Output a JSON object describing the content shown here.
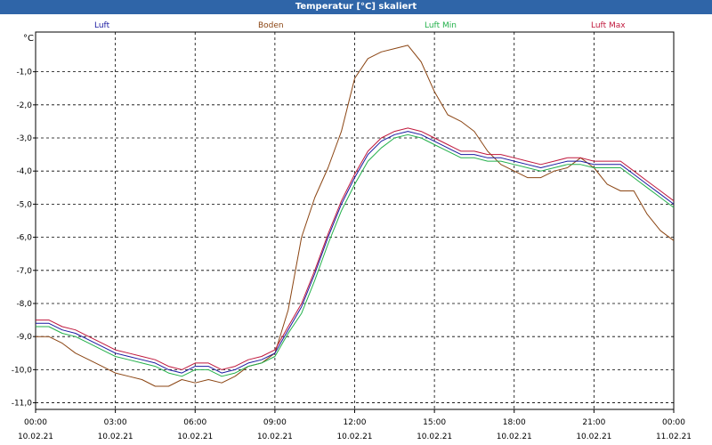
{
  "chart_data": {
    "type": "line",
    "title": "Temperatur [°C] skaliert",
    "ylabel": "°C",
    "xlabel": "",
    "ylim": [
      -11.2,
      0.2
    ],
    "y_ticks": [
      "-1,0",
      "-2,0",
      "-3,0",
      "-4,0",
      "-5,0",
      "-6,0",
      "-7,0",
      "-8,0",
      "-9,0",
      "-10,0",
      "-11,0"
    ],
    "y_tick_values": [
      -1,
      -2,
      -3,
      -4,
      -5,
      -6,
      -7,
      -8,
      -9,
      -10,
      -11
    ],
    "x_ticks": [
      {
        "hours": 0,
        "time": "00:00",
        "date": "10.02.21"
      },
      {
        "hours": 3,
        "time": "03:00",
        "date": "10.02.21"
      },
      {
        "hours": 6,
        "time": "06:00",
        "date": "10.02.21"
      },
      {
        "hours": 9,
        "time": "09:00",
        "date": "10.02.21"
      },
      {
        "hours": 12,
        "time": "12:00",
        "date": "10.02.21"
      },
      {
        "hours": 15,
        "time": "15:00",
        "date": "10.02.21"
      },
      {
        "hours": 18,
        "time": "18:00",
        "date": "10.02.21"
      },
      {
        "hours": 21,
        "time": "21:00",
        "date": "10.02.21"
      },
      {
        "hours": 24,
        "time": "00:00",
        "date": "11.02.21"
      }
    ],
    "x": [
      0,
      0.5,
      1,
      1.5,
      2,
      2.5,
      3,
      3.5,
      4,
      4.5,
      5,
      5.5,
      6,
      6.5,
      7,
      7.5,
      8,
      8.5,
      9,
      9.5,
      10,
      10.5,
      11,
      11.5,
      12,
      12.5,
      13,
      13.5,
      14,
      14.5,
      15,
      15.5,
      16,
      16.5,
      17,
      17.5,
      18,
      18.5,
      19,
      19.5,
      20,
      20.5,
      21,
      21.5,
      22,
      22.5,
      23,
      23.5,
      24
    ],
    "grid": true,
    "legend_position": "top",
    "series": [
      {
        "name": "Luft",
        "color": "#1a1aa0",
        "values": [
          -8.6,
          -8.6,
          -8.8,
          -8.9,
          -9.1,
          -9.3,
          -9.5,
          -9.6,
          -9.7,
          -9.8,
          -10.0,
          -10.1,
          -9.9,
          -9.9,
          -10.1,
          -10.0,
          -9.8,
          -9.7,
          -9.5,
          -8.8,
          -8.1,
          -7.1,
          -6.0,
          -5.0,
          -4.2,
          -3.5,
          -3.1,
          -2.9,
          -2.8,
          -2.9,
          -3.1,
          -3.3,
          -3.5,
          -3.5,
          -3.6,
          -3.6,
          -3.7,
          -3.8,
          -3.9,
          -3.8,
          -3.7,
          -3.7,
          -3.8,
          -3.8,
          -3.8,
          -4.1,
          -4.4,
          -4.7,
          -5.0
        ]
      },
      {
        "name": "Boden",
        "color": "#8b4513",
        "values": [
          -9.0,
          -9.0,
          -9.2,
          -9.5,
          -9.7,
          -9.9,
          -10.1,
          -10.2,
          -10.3,
          -10.5,
          -10.5,
          -10.3,
          -10.4,
          -10.3,
          -10.4,
          -10.2,
          -9.9,
          -9.8,
          -9.5,
          -8.2,
          -6.0,
          -4.8,
          -3.9,
          -2.8,
          -1.2,
          -0.6,
          -0.4,
          -0.3,
          -0.2,
          -0.7,
          -1.6,
          -2.3,
          -2.5,
          -2.8,
          -3.4,
          -3.8,
          -4.0,
          -4.2,
          -4.2,
          -4.0,
          -3.9,
          -3.6,
          -3.9,
          -4.4,
          -4.6,
          -4.6,
          -5.3,
          -5.8,
          -6.1
        ]
      },
      {
        "name": "Luft Min",
        "color": "#22b04a",
        "values": [
          -8.7,
          -8.7,
          -8.9,
          -9.0,
          -9.2,
          -9.4,
          -9.6,
          -9.7,
          -9.8,
          -9.9,
          -10.1,
          -10.2,
          -10.0,
          -10.0,
          -10.2,
          -10.1,
          -9.9,
          -9.8,
          -9.6,
          -8.9,
          -8.3,
          -7.3,
          -6.2,
          -5.2,
          -4.4,
          -3.7,
          -3.3,
          -3.0,
          -2.9,
          -3.0,
          -3.2,
          -3.4,
          -3.6,
          -3.6,
          -3.7,
          -3.7,
          -3.8,
          -3.9,
          -4.0,
          -3.9,
          -3.8,
          -3.8,
          -3.9,
          -3.9,
          -3.9,
          -4.2,
          -4.5,
          -4.8,
          -5.1
        ]
      },
      {
        "name": "Luft Max",
        "color": "#c0183c",
        "values": [
          -8.5,
          -8.5,
          -8.7,
          -8.8,
          -9.0,
          -9.2,
          -9.4,
          -9.5,
          -9.6,
          -9.7,
          -9.9,
          -10.0,
          -9.8,
          -9.8,
          -10.0,
          -9.9,
          -9.7,
          -9.6,
          -9.4,
          -8.7,
          -8.0,
          -7.0,
          -5.9,
          -4.9,
          -4.1,
          -3.4,
          -3.0,
          -2.8,
          -2.7,
          -2.8,
          -3.0,
          -3.2,
          -3.4,
          -3.4,
          -3.5,
          -3.5,
          -3.6,
          -3.7,
          -3.8,
          -3.7,
          -3.6,
          -3.6,
          -3.7,
          -3.7,
          -3.7,
          -4.0,
          -4.3,
          -4.6,
          -4.9
        ]
      }
    ]
  }
}
